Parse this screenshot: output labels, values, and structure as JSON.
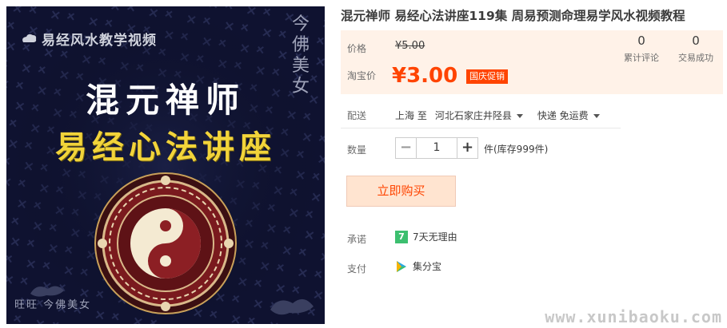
{
  "product_image": {
    "brand_text": "易经风水教学视频",
    "title_line1": "混元禅师",
    "title_line2": "易经心法讲座",
    "vertical_mark": "今佛美女",
    "footer_mark": "旺旺 今佛美女"
  },
  "product": {
    "title": "混元禅师 易经心法讲座119集 周易预测命理易学风水视频教程"
  },
  "price": {
    "label": "价格",
    "original": "¥5.00",
    "promo_label": "淘宝价",
    "promo": "¥3.00",
    "badge": "国庆促销"
  },
  "stats": {
    "reviews_count": "0",
    "reviews_label": "累计评论",
    "sales_count": "0",
    "sales_label": "交易成功"
  },
  "delivery": {
    "label": "配送",
    "from": "上海 至",
    "to": "河北石家庄井陉县",
    "method": "快递 免运费"
  },
  "quantity": {
    "label": "数量",
    "minus": "−",
    "value": "1",
    "plus": "+",
    "stock": "件(库存999件)"
  },
  "buy_button": "立即购买",
  "promise": {
    "label": "承诺",
    "icon_text": "7",
    "text": "7天无理由"
  },
  "payment": {
    "label": "支付",
    "text": "集分宝"
  },
  "watermark": "www.xunibaoku.com",
  "colors": {
    "accent": "#ff4400",
    "panel_bg": "#fff2e8",
    "image_bg": "#0f1230",
    "title_gold": "#f2d43a"
  }
}
